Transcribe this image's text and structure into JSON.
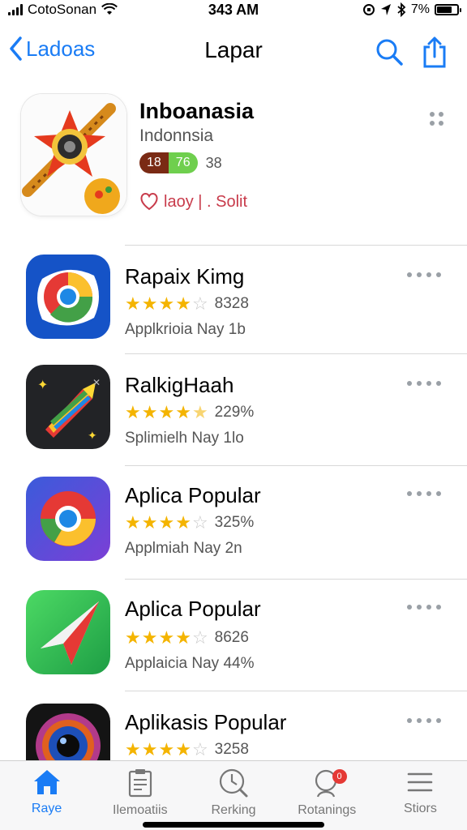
{
  "status_bar": {
    "carrier": "CotoSonan",
    "time": "343 AM",
    "battery_text": "7%"
  },
  "nav": {
    "back_label": "Ladoas",
    "title": "Lapar"
  },
  "featured": {
    "title": "Inboanasia",
    "subtitle": "Indonnsia",
    "badge_primary": "18",
    "badge_secondary": "76",
    "badge_count": "38",
    "action_label": "laoy | . Solit"
  },
  "apps": [
    {
      "name": "Rapaix Kimg",
      "stars": 4,
      "rating_count": "8328",
      "meta": "Applkrioia Nay 1b",
      "icon": "chrome-blue-icon"
    },
    {
      "name": "RalkigHaah",
      "stars": 4.5,
      "rating_count": "229%",
      "meta": "Splimielh Nay 1lo",
      "icon": "rainbow-rocket-icon"
    },
    {
      "name": "Aplica Popular",
      "stars": 4,
      "rating_count": "325%",
      "meta": "Applmiah Nay 2n",
      "icon": "chrome-icon"
    },
    {
      "name": "Aplica Popular",
      "stars": 4,
      "rating_count": "8626",
      "meta": "Applaicia Nay 44%",
      "icon": "paper-plane-icon"
    },
    {
      "name": "Aplikasis Popular",
      "stars": 4,
      "rating_count": "3258",
      "meta": "",
      "icon": "camera-lens-icon"
    }
  ],
  "tabs": [
    {
      "label": "Raye",
      "icon": "home-icon",
      "active": true
    },
    {
      "label": "Ilemoatiis",
      "icon": "clipboard-icon",
      "active": false
    },
    {
      "label": "Rerking",
      "icon": "clock-search-icon",
      "active": false
    },
    {
      "label": "Rotanings",
      "icon": "person-search-icon",
      "active": false,
      "badge": "0"
    },
    {
      "label": "Stiors",
      "icon": "menu-icon",
      "active": false
    }
  ],
  "colors": {
    "accent": "#1a7cf5",
    "star": "#f4b400",
    "action": "#c83b4b"
  }
}
